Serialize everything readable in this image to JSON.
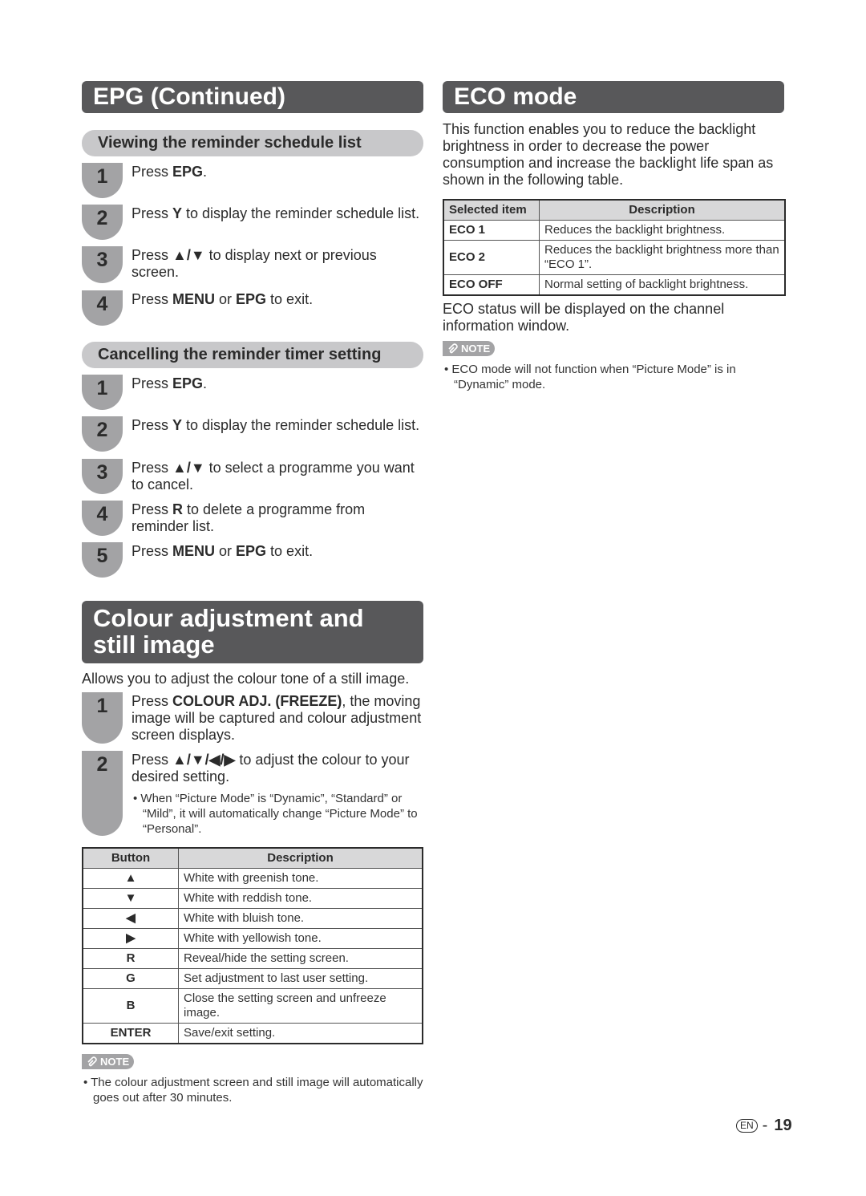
{
  "epg": {
    "title": "EPG (Continued)",
    "viewing": {
      "subtitle": "Viewing the reminder schedule list",
      "steps": [
        {
          "num": "1",
          "pre": "Press ",
          "b1": "EPG",
          "post": "."
        },
        {
          "num": "2",
          "pre": "Press ",
          "b1": "Y",
          "post": " to display the reminder schedule list."
        },
        {
          "num": "3",
          "pre": "Press ",
          "b1": "▲/▼",
          "post": " to display next or previous screen."
        },
        {
          "num": "4",
          "pre": "Press ",
          "b1": "MENU",
          "mid": " or ",
          "b2": "EPG",
          "post": " to exit."
        }
      ]
    },
    "cancelling": {
      "subtitle": "Cancelling the reminder timer setting",
      "steps": [
        {
          "num": "1",
          "pre": "Press ",
          "b1": "EPG",
          "post": "."
        },
        {
          "num": "2",
          "pre": "Press ",
          "b1": "Y",
          "post": " to display the reminder schedule list."
        },
        {
          "num": "3",
          "pre": "Press ",
          "b1": "▲/▼",
          "post": " to select a programme you want to cancel."
        },
        {
          "num": "4",
          "pre": "Press ",
          "b1": "R",
          "post": " to delete a programme from reminder list."
        },
        {
          "num": "5",
          "pre": "Press ",
          "b1": "MENU",
          "mid": " or ",
          "b2": "EPG",
          "post": " to exit."
        }
      ]
    }
  },
  "colour": {
    "title": "Colour adjustment and still image",
    "intro": "Allows you to adjust the colour tone of a still image.",
    "steps": [
      {
        "num": "1",
        "pre": "Press ",
        "b1": "COLOUR ADJ. (FREEZE)",
        "post": ", the moving image will be captured and colour adjustment screen displays."
      },
      {
        "num": "2",
        "pre": "Press ",
        "b1": "▲/▼/◀/▶",
        "post": " to adjust the colour to your desired setting.",
        "sub": "• When “Picture Mode” is “Dynamic”, “Standard” or “Mild”, it will automatically change “Picture Mode” to “Personal”."
      }
    ],
    "table": {
      "headers": [
        "Button",
        "Description"
      ],
      "rows": [
        [
          "▲",
          "White with greenish tone."
        ],
        [
          "▼",
          "White with reddish tone."
        ],
        [
          "◀",
          "White with bluish tone."
        ],
        [
          "▶",
          "White with yellowish tone."
        ],
        [
          "R",
          "Reveal/hide the setting screen."
        ],
        [
          "G",
          "Set adjustment to last user setting."
        ],
        [
          "B",
          "Close the setting screen and unfreeze image."
        ],
        [
          "ENTER",
          "Save/exit setting."
        ]
      ]
    },
    "note_label": "NOTE",
    "note": "• The colour adjustment screen and still image will automatically goes out after 30 minutes."
  },
  "eco": {
    "title": "ECO mode",
    "intro": "This function enables you to reduce the backlight brightness in order to decrease the power consumption and increase the backlight life span as shown in the following table.",
    "table": {
      "headers": [
        "Selected item",
        "Description"
      ],
      "rows": [
        [
          "ECO 1",
          "Reduces the backlight brightness."
        ],
        [
          "ECO 2",
          "Reduces the backlight brightness more than “ECO 1”."
        ],
        [
          "ECO OFF",
          "Normal setting of backlight brightness."
        ]
      ]
    },
    "status": "ECO status will be displayed on the channel information window.",
    "note_label": "NOTE",
    "note": "• ECO mode will not function when “Picture Mode” is in “Dynamic” mode."
  },
  "footer": {
    "lang": "EN",
    "dash": "-",
    "page": "19"
  }
}
